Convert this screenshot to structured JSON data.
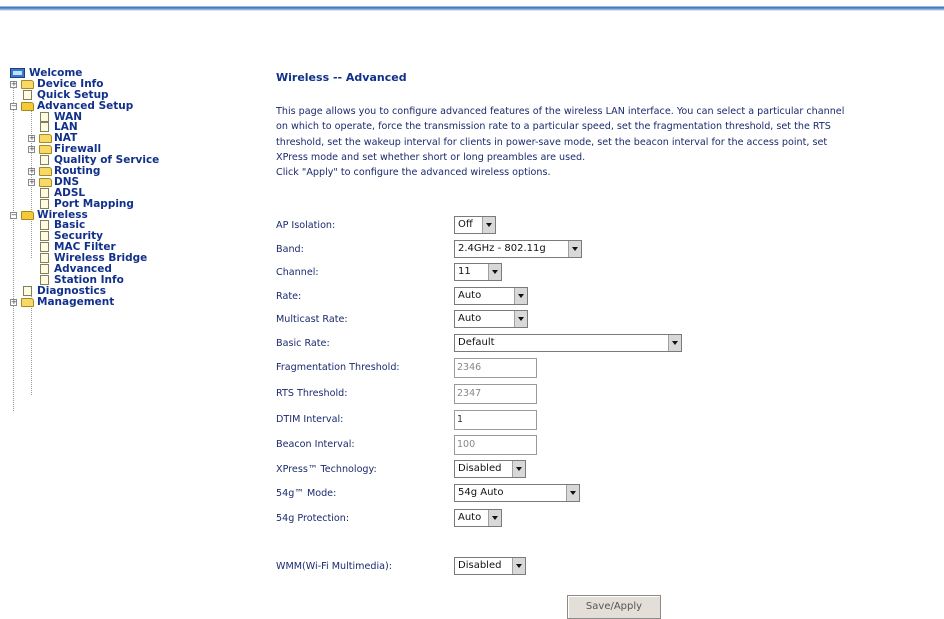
{
  "nav": {
    "root": "Welcome",
    "device_info": "Device Info",
    "quick_setup": "Quick Setup",
    "advanced_setup": "Advanced Setup",
    "wan": "WAN",
    "lan": "LAN",
    "nat": "NAT",
    "firewall": "Firewall",
    "qos": "Quality of Service",
    "routing": "Routing",
    "dns": "DNS",
    "adsl": "ADSL",
    "port_mapping": "Port Mapping",
    "wireless": "Wireless",
    "basic": "Basic",
    "security": "Security",
    "mac_filter": "MAC Filter",
    "wireless_bridge": "Wireless Bridge",
    "advanced": "Advanced",
    "station_info": "Station Info",
    "diagnostics": "Diagnostics",
    "management": "Management"
  },
  "page": {
    "title": "Wireless -- Advanced",
    "description": "This page allows you to configure advanced features of the wireless LAN interface. You can select a particular channel\non which to operate, force the transmission rate to a particular speed, set the fragmentation threshold, set the RTS\nthreshold, set the wakeup interval for clients in power-save mode, set the beacon interval for the access point, set\nXPress mode and set whether short or long preambles are used.\nClick \"Apply\" to configure the advanced wireless options."
  },
  "form": {
    "ap_isolation": {
      "label": "AP Isolation:",
      "value": "Off"
    },
    "band": {
      "label": "Band:",
      "value": "2.4GHz - 802.11g"
    },
    "channel": {
      "label": "Channel:",
      "value": "11"
    },
    "rate": {
      "label": "Rate:",
      "value": "Auto"
    },
    "multicast_rate": {
      "label": "Multicast Rate:",
      "value": "Auto"
    },
    "basic_rate": {
      "label": "Basic Rate:",
      "value": "Default"
    },
    "frag_threshold": {
      "label": "Fragmentation Threshold:",
      "value": "2346"
    },
    "rts_threshold": {
      "label": "RTS Threshold:",
      "value": "2347"
    },
    "dtim_interval": {
      "label": "DTIM Interval:",
      "value": "1"
    },
    "beacon_interval": {
      "label": "Beacon Interval:",
      "value": "100"
    },
    "xpress": {
      "label": "XPress™ Technology:",
      "value": "Disabled"
    },
    "mode_54g": {
      "label": "54g™ Mode:",
      "value": "54g Auto"
    },
    "protection_54g": {
      "label": "54g Protection:",
      "value": "Auto"
    },
    "wmm": {
      "label": "WMM(Wi-Fi Multimedia):",
      "value": "Disabled"
    }
  },
  "buttons": {
    "apply": "Save/Apply"
  },
  "colors": {
    "nav_text": "#11308a",
    "body_text": "#1b2a6e",
    "folder": "#f4c93a"
  }
}
